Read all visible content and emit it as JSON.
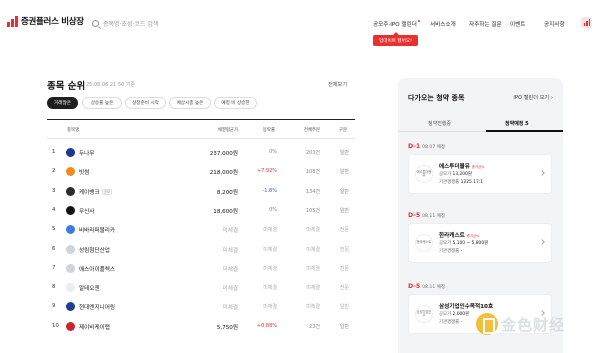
{
  "header": {
    "logo_text": "증권플러스 비상장",
    "search_placeholder": "종목명·초성·코드 검색",
    "nav": [
      {
        "label": "공모주·IPO 캘린더",
        "has_dot": true
      },
      {
        "label": "서비스소개",
        "has_dot": false
      },
      {
        "label": "자주하는 질문",
        "has_dot": false
      },
      {
        "label": "이벤트",
        "has_dot": false
      },
      {
        "label": "공지사항",
        "has_dot": false
      }
    ],
    "tooltip": "업데이트 됐어요!"
  },
  "ranking": {
    "title": "종목 순위",
    "date": "25.08.06 21:50 기준",
    "view_all": "전체보기",
    "chips": [
      "거래많은",
      "상승률 높은",
      "상장준비 시작",
      "예상시총 높은",
      "예정 비 상승한"
    ],
    "active_chip": 0,
    "columns": [
      "종목명",
      "체결평균가",
      "등락률",
      "전체주문",
      "구분"
    ],
    "rows": [
      {
        "rank": "1",
        "name": "두나무",
        "tag": "",
        "price": "237,000원",
        "rate": "0%",
        "rate_dir": "flat",
        "volume": "203건",
        "type": "일반",
        "muted": false,
        "logo_color": "#1d3a8a"
      },
      {
        "rank": "2",
        "name": "빗썸",
        "tag": "",
        "price": "218,000원",
        "rate": "+7.92%",
        "rate_dir": "up",
        "volume": "108건",
        "type": "일반",
        "muted": false,
        "logo_color": "#f08c1e"
      },
      {
        "rank": "3",
        "name": "케이뱅크",
        "tag": "공모",
        "price": "8,200원",
        "rate": "-1.8%",
        "rate_dir": "down",
        "volume": "134건",
        "type": "일반",
        "muted": false,
        "logo_color": "#2b2b2b"
      },
      {
        "rank": "4",
        "name": "무신사",
        "tag": "",
        "price": "18,600원",
        "rate": "0%",
        "rate_dir": "flat",
        "volume": "105건",
        "type": "일반",
        "muted": false,
        "logo_color": "#111111"
      },
      {
        "rank": "5",
        "name": "비바리퍼블리카",
        "tag": "",
        "price": "미체결",
        "rate": "미체결",
        "rate_dir": "flat",
        "volume": "미체결",
        "type": "전문",
        "muted": true,
        "logo_color": "#3d7be8"
      },
      {
        "rank": "6",
        "name": "성림첨단산업",
        "tag": "",
        "price": "미체결",
        "rate": "미체결",
        "rate_dir": "flat",
        "volume": "미체결",
        "type": "전문",
        "muted": true,
        "logo_color": "#cfd3da"
      },
      {
        "rank": "7",
        "name": "에스아이플렉스",
        "tag": "",
        "price": "미체결",
        "rate": "미체결",
        "rate_dir": "flat",
        "volume": "미체결",
        "type": "전문",
        "muted": true,
        "logo_color": "#cfd3da"
      },
      {
        "rank": "8",
        "name": "알테오젠",
        "tag": "",
        "price": "미체결",
        "rate": "미체결",
        "rate_dir": "flat",
        "volume": "미체결",
        "type": "전문",
        "muted": true,
        "logo_color": "#e9ecf1"
      },
      {
        "rank": "9",
        "name": "현대엔지니어링",
        "tag": "",
        "price": "미체결",
        "rate": "미체결",
        "rate_dir": "flat",
        "volume": "미체결",
        "type": "일반",
        "muted": true,
        "logo_color": "#1f3f8f"
      },
      {
        "rank": "10",
        "name": "제이비케이랩",
        "tag": "",
        "price": "5,750원",
        "rate": "+0.88%",
        "rate_dir": "up",
        "volume": "23건",
        "type": "일반",
        "muted": false,
        "logo_color": "#c8262d"
      }
    ]
  },
  "panel": {
    "title": "다가오는 청약 종목",
    "link": "IPO 캘린더 보기",
    "tabs": [
      "청약진행중",
      "청약예정 5"
    ],
    "active_tab": 1,
    "items": [
      {
        "dday": "D-1",
        "date": "08.07 예정",
        "logo_text": "에스투더블유",
        "name": "에스투더블유",
        "badge": "증거금%",
        "line1_label": "공모가",
        "line1_value": "13,200원",
        "line2_label": "기관경쟁률",
        "line2_value": "1225.17:1"
      },
      {
        "dday": "D-5",
        "date": "08.11 예정",
        "logo_text": "한라캐스트",
        "name": "한라캐스트",
        "badge": "증거금%",
        "line1_label": "공모가",
        "line1_value": "5,100 ~ 5,800원",
        "line2_label": "기관경쟁률",
        "line2_value": "-"
      },
      {
        "dday": "D-5",
        "date": "08.11 예정",
        "logo_text": "삼성기업인수",
        "name": "삼성기업인수목적10호",
        "badge": "",
        "line1_label": "공모가",
        "line1_value": "2,000원",
        "line2_label": "기관경쟁률",
        "line2_value": "-"
      }
    ]
  },
  "watermark_text": "金色财经"
}
